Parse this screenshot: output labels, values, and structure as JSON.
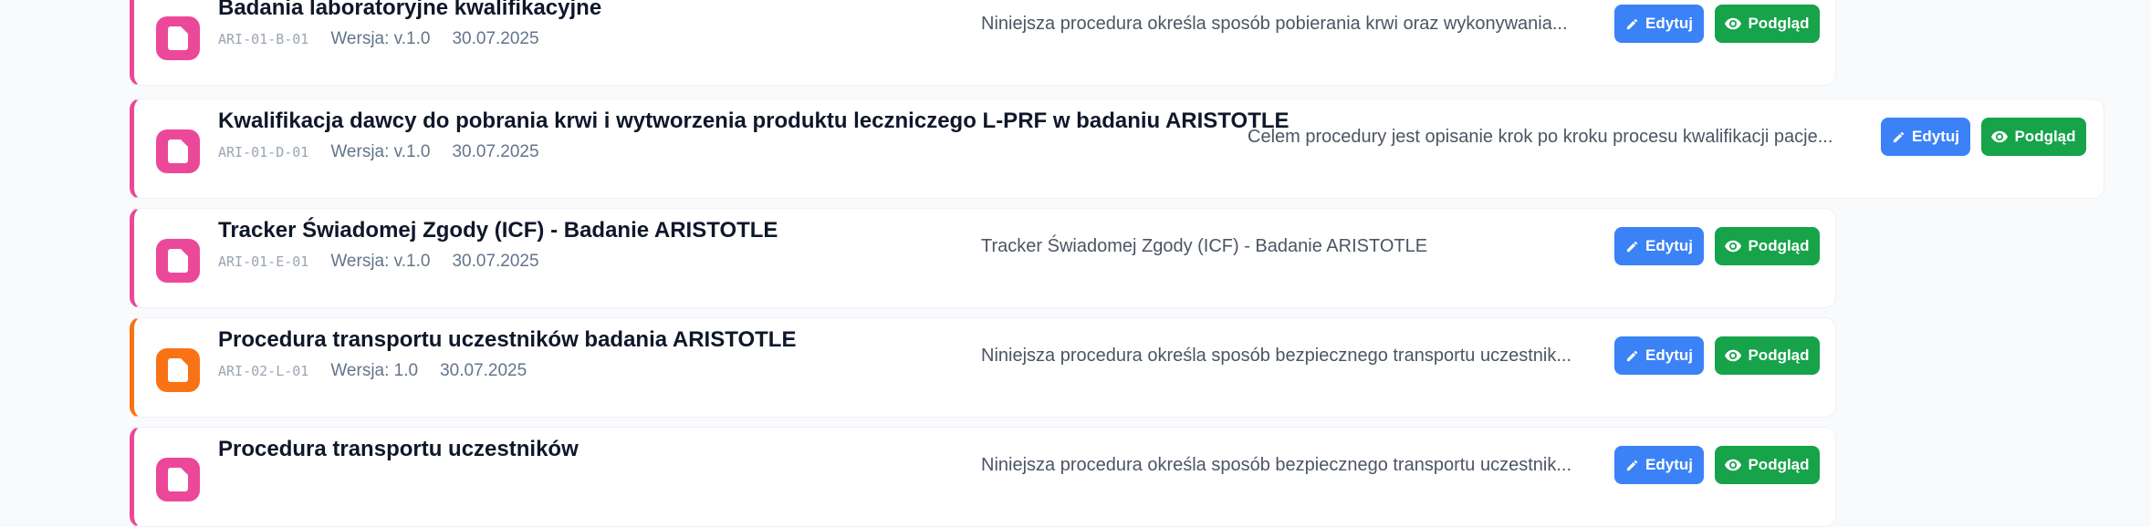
{
  "colors": {
    "pink": "#ec4899",
    "orange": "#f97316",
    "edit_button": "#3b82f6",
    "view_button": "#16a34a"
  },
  "actions": {
    "edit_label": "Edytuj",
    "view_label": "Podgląd"
  },
  "documents": [
    {
      "title": "Badania laboratoryjne kwalifikacyjne",
      "code": "ARI-01-B-01",
      "version": "Wersja: v.1.0",
      "date": "30.07.2025",
      "description": "Niniejsza procedura określa sposób pobierania krwi oraz wykonywania...",
      "accent": "pink"
    },
    {
      "title": "Kwalifikacja dawcy do pobrania krwi i wytworzenia produktu leczniczego L-PRF w badaniu ARISTOTLE",
      "code": "ARI-01-D-01",
      "version": "Wersja: v.1.0",
      "date": "30.07.2025",
      "description": "Celem procedury jest opisanie krok po kroku procesu kwalifikacji pacje...",
      "accent": "pink"
    },
    {
      "title": "Tracker Świadomej Zgody (ICF) - Badanie ARISTOTLE",
      "code": "ARI-01-E-01",
      "version": "Wersja: v.1.0",
      "date": "30.07.2025",
      "description": "Tracker Świadomej Zgody (ICF) - Badanie ARISTOTLE",
      "accent": "pink"
    },
    {
      "title": "Procedura transportu uczestników badania ARISTOTLE",
      "code": "ARI-02-L-01",
      "version": "Wersja: 1.0",
      "date": "30.07.2025",
      "description": "Niniejsza procedura określa sposób bezpiecznego transportu uczestnik...",
      "accent": "orange"
    },
    {
      "title": "Procedura transportu uczestników",
      "code": "",
      "version": "",
      "date": "",
      "description": "Niniejsza procedura określa sposób bezpiecznego transportu uczestnik...",
      "accent": "pink"
    }
  ]
}
